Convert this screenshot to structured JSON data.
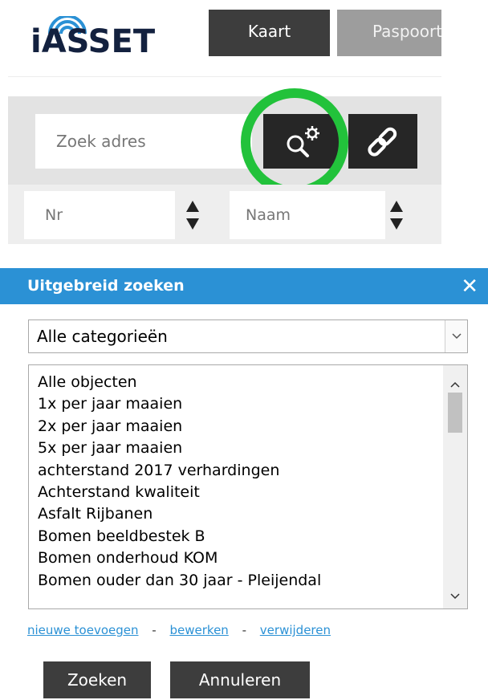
{
  "header": {
    "logo_text": "iASSET",
    "nav": [
      {
        "label": "Kaart"
      },
      {
        "label": "Paspoort"
      }
    ]
  },
  "search": {
    "placeholder": "Zoek adres",
    "advanced_icon": "search-gear-icon",
    "link_icon": "link-icon"
  },
  "filters": {
    "nr_label": "Nr",
    "naam_label": "Naam"
  },
  "dialog": {
    "title": "Uitgebreid zoeken",
    "close_label": "✕",
    "category_selected": "Alle categorieën",
    "items": [
      "Alle objecten",
      "1x per jaar maaien",
      "2x per jaar maaien",
      "5x per jaar maaien",
      "achterstand 2017 verhardingen",
      "Achterstand kwaliteit",
      "Asfalt Rijbanen",
      "Bomen beeldbestek B",
      "Bomen onderhoud KOM",
      "Bomen ouder dan 30 jaar - Pleijendal"
    ],
    "links": {
      "add": "nieuwe toevoegen",
      "edit": "bewerken",
      "delete": "verwijderen",
      "separator": "-"
    },
    "buttons": {
      "search": "Zoeken",
      "cancel": "Annuleren"
    }
  },
  "colors": {
    "accent": "#2b91d5",
    "highlight": "#22c23b",
    "dark_button": "#3d3d3d"
  }
}
